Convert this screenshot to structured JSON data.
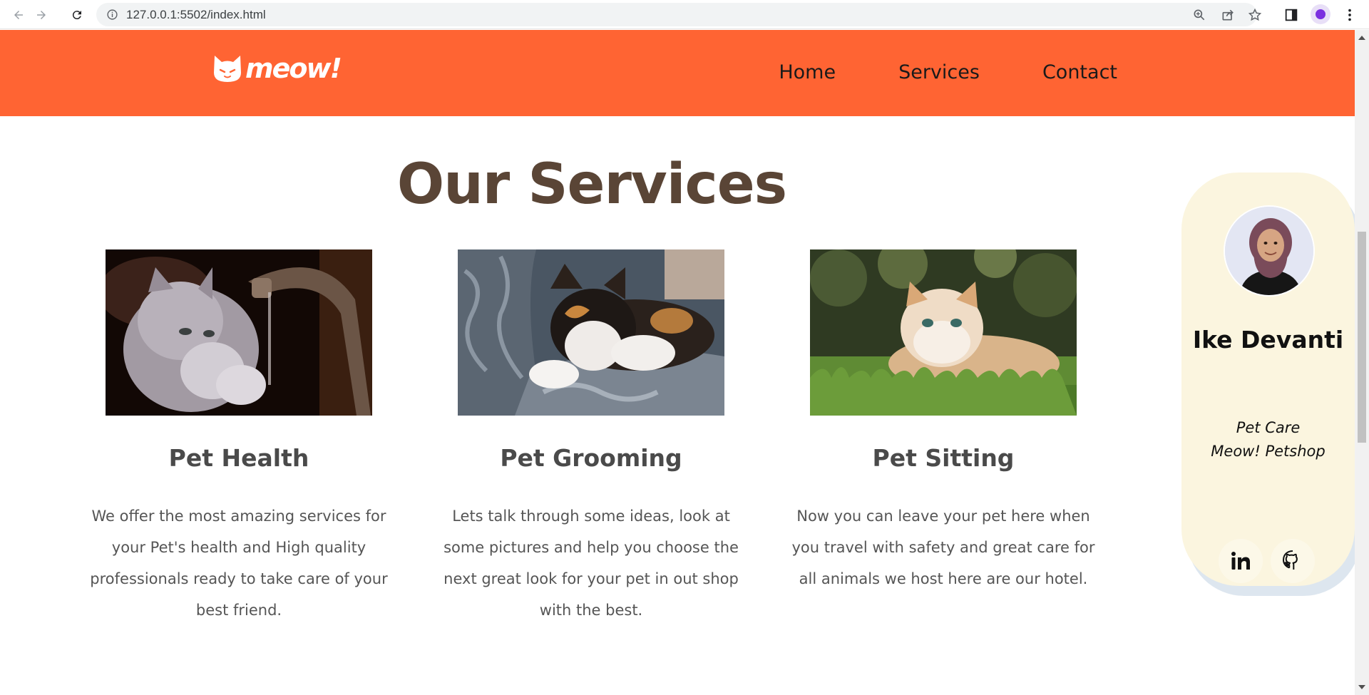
{
  "browser": {
    "url": "127.0.0.1:5502/index.html"
  },
  "header": {
    "logo_text": "meow!",
    "nav": [
      {
        "label": "Home"
      },
      {
        "label": "Services"
      },
      {
        "label": "Contact"
      }
    ],
    "colors": {
      "bar": "#ff6433"
    }
  },
  "services": {
    "title": "Our Services",
    "cards": [
      {
        "title": "Pet Health",
        "image": "kitten-drinking-from-faucet",
        "text": "We offer the most amazing services for your Pet's health and High quality professionals ready to take care of your best friend."
      },
      {
        "title": "Pet Grooming",
        "image": "calico-cat-sleeping-on-blanket",
        "text": "Lets talk through some ideas, look at some pictures and help you choose the next great look for your pet in out shop with the best."
      },
      {
        "title": "Pet Sitting",
        "image": "persian-cat-lying-on-grass",
        "text": "Now you can leave your pet here when you travel with safety and great care for all animals we host here are our hotel."
      }
    ]
  },
  "profile": {
    "name": "Ike Devanti",
    "role": "Pet Care Meow! Petshop",
    "socials": [
      {
        "icon": "linkedin-icon"
      },
      {
        "icon": "github-icon"
      }
    ],
    "colors": {
      "card": "#fbf5df",
      "title": "#5a4536"
    }
  }
}
